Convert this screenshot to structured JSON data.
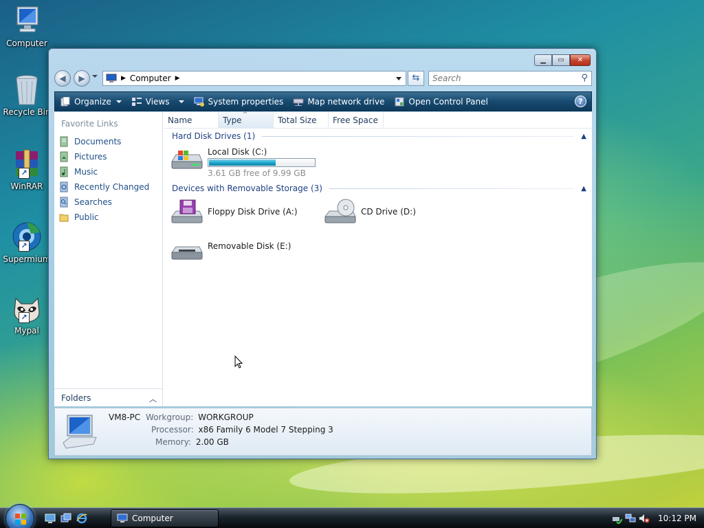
{
  "desktop": {
    "icons": [
      {
        "name": "computer",
        "label": "Computer"
      },
      {
        "name": "recycle-bin",
        "label": "Recycle Bin"
      },
      {
        "name": "winrar",
        "label": "WinRAR"
      },
      {
        "name": "supermium",
        "label": "Supermium"
      },
      {
        "name": "mypal",
        "label": "Mypal"
      }
    ]
  },
  "window": {
    "address": {
      "root_label": "Computer"
    },
    "search": {
      "placeholder": "Search"
    },
    "toolbar": {
      "organize": "Organize",
      "views": "Views",
      "system_properties": "System properties",
      "map_network_drive": "Map network drive",
      "open_control_panel": "Open Control Panel"
    },
    "nav": {
      "title": "Favorite Links",
      "links": [
        "Documents",
        "Pictures",
        "Music",
        "Recently Changed",
        "Searches",
        "Public"
      ],
      "folders_label": "Folders"
    },
    "columns": [
      "Name",
      "Type",
      "Total Size",
      "Free Space"
    ],
    "groups": {
      "hard_disk": "Hard Disk Drives (1)",
      "removable": "Devices with Removable Storage (3)"
    },
    "drives": {
      "local_disk": {
        "name": "Local Disk (C:)",
        "free_text": "3.61 GB free of 9.99 GB",
        "used_fraction": 0.64
      },
      "floppy": {
        "name": "Floppy Disk Drive (A:)"
      },
      "cd": {
        "name": "CD Drive (D:)"
      },
      "removable": {
        "name": "Removable Disk (E:)"
      }
    },
    "details": {
      "computer_name": "VM8-PC",
      "workgroup_label": "Workgroup:",
      "workgroup_value": "WORKGROUP",
      "processor_label": "Processor:",
      "processor_value": "x86 Family 6 Model 7 Stepping 3",
      "memory_label": "Memory:",
      "memory_value": "2.00 GB"
    }
  },
  "taskbar": {
    "task_label": "Computer",
    "clock": "10:12 PM"
  },
  "colors": {
    "toolbar": "#174a70",
    "link": "#1e4e87",
    "progress": "#1aa5c9"
  }
}
